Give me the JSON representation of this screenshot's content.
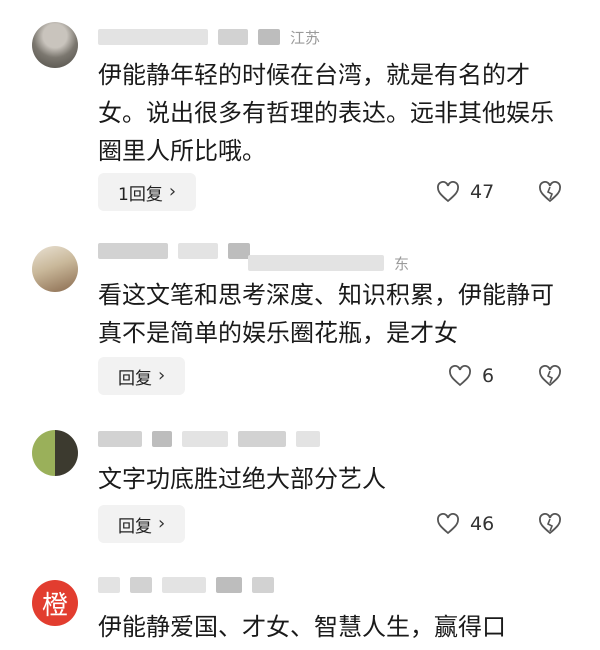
{
  "comments": [
    {
      "location": "江苏",
      "text": "伊能静年轻的时候在台湾，就是有名的才女。说出很多有哲理的表达。远非其他娱乐圈里人所比哦。",
      "reply_label": "1回复",
      "likes": "47"
    },
    {
      "location": "东",
      "text": "看这文笔和思考深度、知识积累，伊能静可真不是简单的娱乐圈花瓶，是才女",
      "reply_label": "回复",
      "likes": "6"
    },
    {
      "text": "文字功底胜过绝大部分艺人",
      "reply_label": "回复",
      "likes": "46"
    },
    {
      "avatar_char": "橙",
      "text": "伊能静爱国、才女、智慧人生，赢得口"
    }
  ],
  "icons": {
    "like": "heart-outline-icon",
    "dislike": "broken-heart-icon",
    "reply_arrow": "chevron-right-icon"
  },
  "colors": {
    "avatar_red": "#e23d2f",
    "button_bg": "#f2f2f2"
  }
}
